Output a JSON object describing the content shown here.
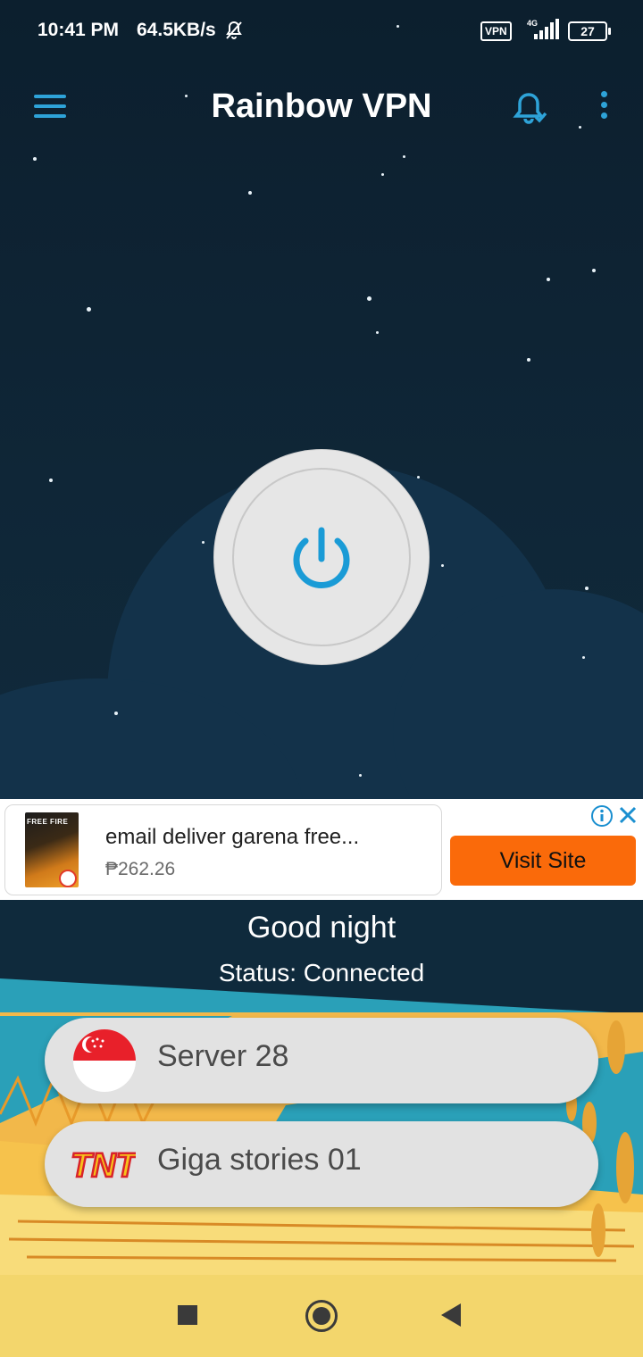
{
  "status_bar": {
    "time": "10:41 PM",
    "speed": "64.5KB/s",
    "vpn_badge": "VPN",
    "network": "4G",
    "battery": "27"
  },
  "toolbar": {
    "title": "Rainbow VPN",
    "menu_icon": "hamburger-menu-icon",
    "bell_icon": "bell-check-icon",
    "more_icon": "more-vert-icon"
  },
  "power": {
    "icon": "power-icon",
    "color": "#1a9bd6"
  },
  "ad": {
    "thumb_text": "FREE FIRE",
    "title": "email deliver garena free...",
    "price": "₱262.26",
    "cta": "Visit Site",
    "cta_color": "#fa6a0a"
  },
  "main": {
    "greeting": "Good night",
    "status": "Status: Connected",
    "server": {
      "label": "Server 28",
      "flag": "singapore-flag-icon"
    },
    "config": {
      "label": "Giga stories 01",
      "logo": "TNT",
      "logo_icon": "tnt-logo-icon"
    }
  }
}
